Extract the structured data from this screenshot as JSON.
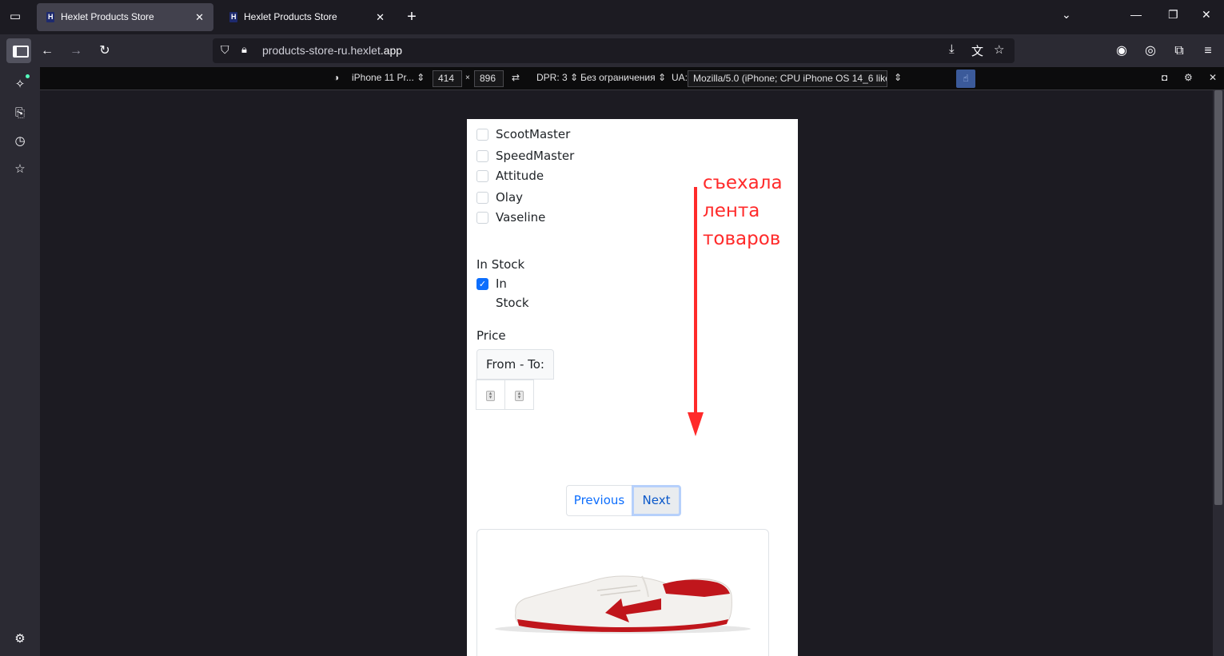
{
  "browser": {
    "tabs": [
      {
        "title": "Hexlet Products Store",
        "active": true
      },
      {
        "title": "Hexlet Products Store",
        "active": false
      }
    ],
    "url_main": "products-store-ru.hexlet",
    "url_tail": ".app"
  },
  "rdm": {
    "device": "iPhone 11 Pr...",
    "width": "414",
    "times": "×",
    "height": "896",
    "dpr": "DPR: 3",
    "throttle": "Без ограничения",
    "ua_label": "UA:",
    "ua_value": "Mozilla/5.0 (iPhone; CPU iPhone OS 14_6 like M"
  },
  "filters": {
    "brands": [
      {
        "label": "ScootMaster",
        "checked": false
      },
      {
        "label": "SpeedMaster",
        "checked": false
      },
      {
        "label": "Attitude",
        "checked": false
      },
      {
        "label": "Olay",
        "checked": false
      },
      {
        "label": "Vaseline",
        "checked": false
      }
    ],
    "in_stock_heading": "In Stock",
    "in_stock_label_1": "In",
    "in_stock_label_2": "Stock",
    "price_heading": "Price",
    "price_addon": "From - To:"
  },
  "pagination": {
    "previous": "Previous",
    "next": "Next"
  },
  "annotation": {
    "line1": "съехала",
    "line2": "лента",
    "line3": "товаров",
    "color": "#ff2a2a"
  },
  "colors": {
    "accent": "#0d6efd",
    "shoe_red": "#c0161c"
  }
}
